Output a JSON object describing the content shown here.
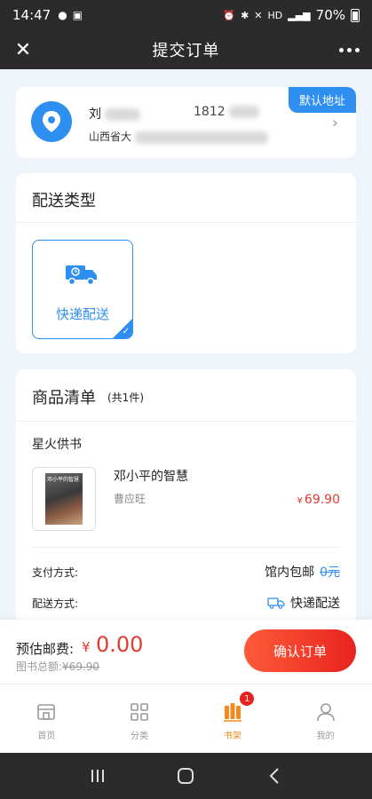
{
  "status_bar": {
    "time": "14:47",
    "network": "HD",
    "battery": "70%"
  },
  "header": {
    "title": "提交订单"
  },
  "address": {
    "name": "刘",
    "phone": "1812",
    "province": "山西省大",
    "badge": "默认地址"
  },
  "delivery": {
    "section_title": "配送类型",
    "option_label": "快递配送"
  },
  "goods": {
    "section_title": "商品清单",
    "count": "(共1件)",
    "store_name": "星火供书",
    "book": {
      "cover_text": "邓小平的智慧",
      "title": "邓小平的智慧",
      "author": "曹应旺",
      "currency": "¥",
      "price": "69.90"
    },
    "payment_label": "支付方式:",
    "payment_value": "馆内包邮",
    "payment_strike": "0元",
    "shipping_label": "配送方式:",
    "shipping_value": "快递配送"
  },
  "footer": {
    "postage_label": "预估邮费:",
    "currency": "¥",
    "postage_value": "0.00",
    "books_total_label": "图书总额:",
    "books_total_value": "¥69.90",
    "confirm_label": "确认订单"
  },
  "tabbar": {
    "tabs": [
      {
        "label": "首页",
        "icon": "home-icon"
      },
      {
        "label": "分类",
        "icon": "grid-icon"
      },
      {
        "label": "书架",
        "icon": "bookshelf-icon",
        "badge": "1"
      },
      {
        "label": "我的",
        "icon": "user-icon"
      }
    ]
  },
  "colors": {
    "accent_blue": "#2f8ff0",
    "price_red": "#e23b2f",
    "active_orange": "#f28a1e"
  }
}
